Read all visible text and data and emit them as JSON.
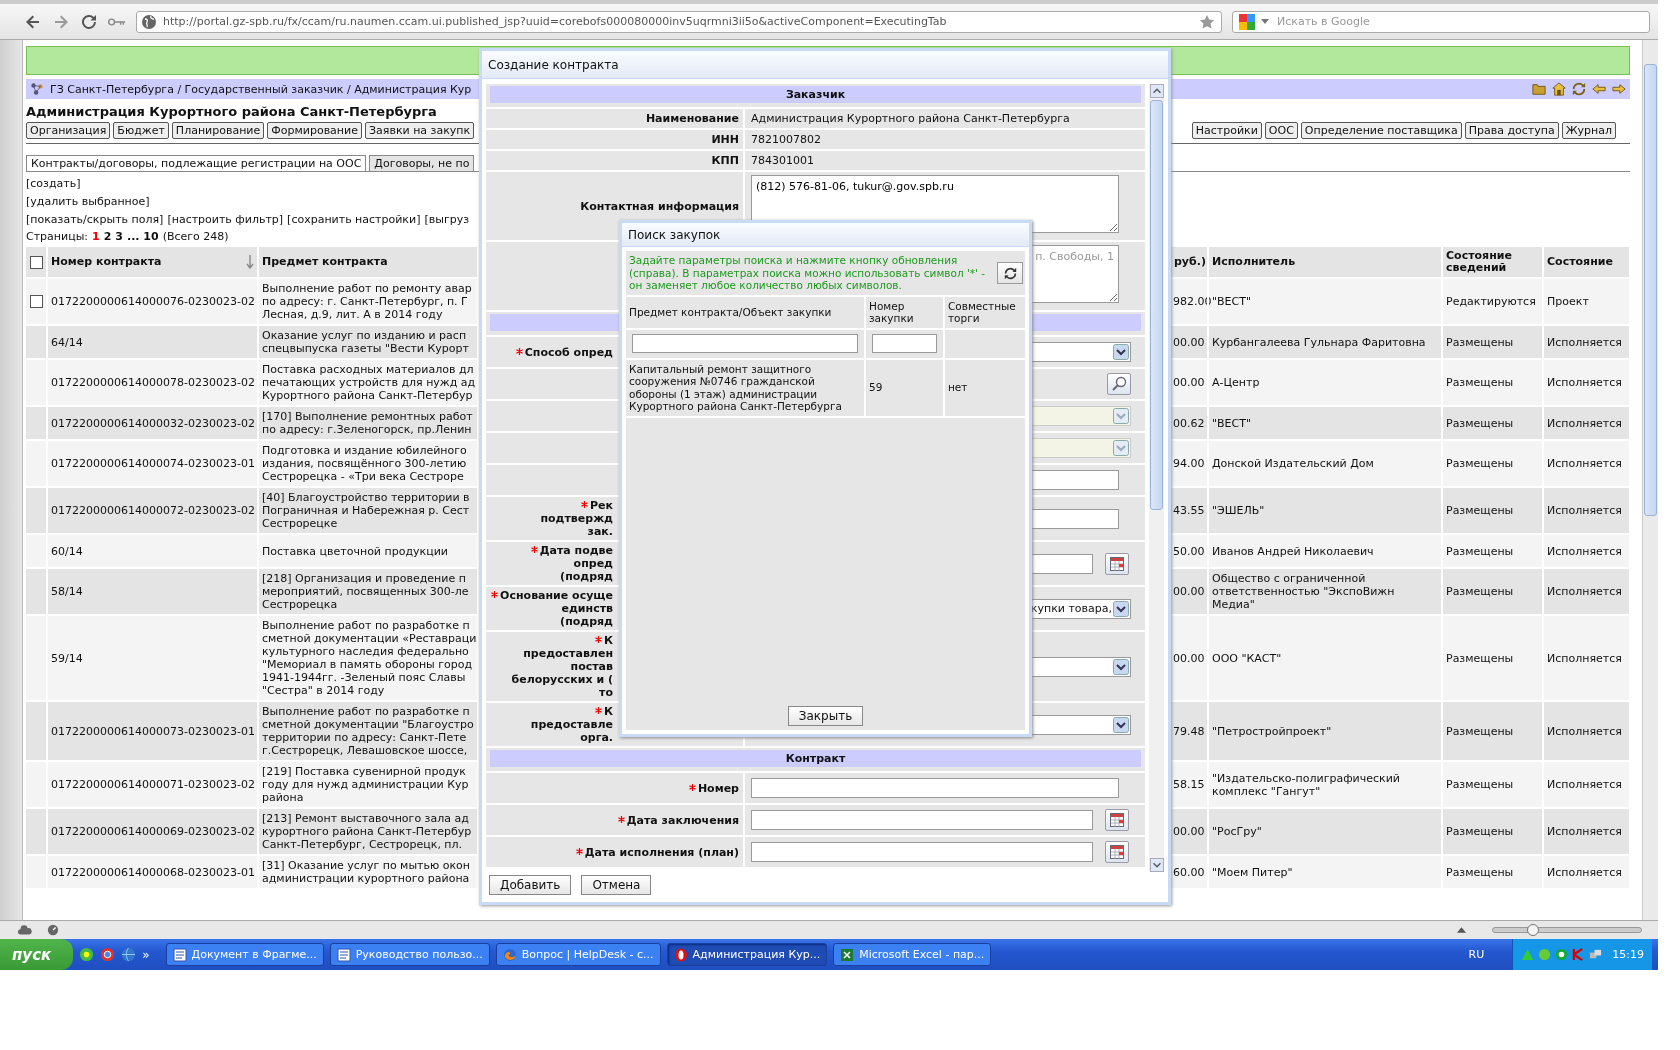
{
  "browser": {
    "url": "http://portal.gz-spb.ru/fx/ccam/ru.naumen.ccam.ui.published_jsp?uuid=corebofs000080000inv5uqrmni3ii5o&activeComponent=ExecutingTab",
    "search_placeholder": "Искать в Google"
  },
  "breadcrumb": "ГЗ Санкт-Петербурга / Государственный заказчик / Администрация Кур",
  "title": "Администрация Курортного района Санкт-Петербурга",
  "tabs": [
    {
      "label": "Организация",
      "selected": false
    },
    {
      "label": "Бюджет",
      "selected": false
    },
    {
      "label": "Планирование",
      "selected": false
    },
    {
      "label": "Формирование",
      "selected": false
    },
    {
      "label": "Заявки на закупк",
      "selected": false
    }
  ],
  "tabs_right": [
    {
      "label": "Настройки",
      "selected": false
    },
    {
      "label": "ООС",
      "selected": false
    },
    {
      "label": "Определение поставщика",
      "selected": false
    },
    {
      "label": "Права доступа",
      "selected": false
    },
    {
      "label": "Журнал",
      "selected": false
    }
  ],
  "subtabs": [
    {
      "label": "Контракты/договоры, подлежащие регистрации на ООС",
      "selected": true
    },
    {
      "label": "Договоры, не по",
      "selected": false
    }
  ],
  "actions": [
    "[создать]",
    "[удалить выбранное]"
  ],
  "links": [
    "[показать/скрыть поля]",
    "[настроить фильтр]",
    "[сохранить настройки]",
    "[выгруз"
  ],
  "pagination": {
    "label": "Страницы:",
    "pages": [
      {
        "label": "1",
        "selected": true
      },
      {
        "label": "2",
        "selected": false
      },
      {
        "label": "3",
        "selected": false
      },
      {
        "label": "... 10",
        "selected": false
      }
    ],
    "total": "(Всего 248)"
  },
  "table": {
    "select_all": {
      "checked": false
    },
    "columns": [
      {
        "label": "Номер контракта",
        "sorted": true
      },
      {
        "label": "Предмет контракта",
        "sorted": false
      },
      {
        "label": "руб.)"
      },
      {
        "label": "Исполнитель",
        "sorted": false
      },
      {
        "label": "Состояние сведений",
        "sorted": false
      },
      {
        "label": "Состояние",
        "sorted": false
      }
    ],
    "rows": [
      {
        "selectable": true,
        "checked": false,
        "number": "0172200000614000076-0230023-02",
        "subject": [
          "Выполнение работ по ремонту авар",
          "по адресу: г. Санкт-Петербург, п. Г",
          "Лесная, д.9, лит. А в 2014 году"
        ],
        "price": "982.00",
        "executor": "\"ВЕСТ\"",
        "info_state": "Редактируются",
        "state": "Проект"
      },
      {
        "selectable": false,
        "number": "64/14",
        "subject": [
          "Оказание услуг по изданию и расп",
          "спецвыпуска газеты \"Вести Курорт"
        ],
        "price": "00.00",
        "executor": "Курбангалеева Гульнара Фаритовна",
        "info_state": "Размещены",
        "state": "Исполняется"
      },
      {
        "selectable": false,
        "number": "0172200000614000078-0230023-02",
        "subject": [
          "Поставка расходных материалов дл",
          "печатающих устройств для нужд ад",
          "Курортного района Санкт-Петербур"
        ],
        "price": "00.00",
        "executor": "А-Центр",
        "info_state": "Размещены",
        "state": "Исполняется"
      },
      {
        "selectable": false,
        "number": "0172200000614000032-0230023-02",
        "subject": [
          "[170] Выполнение ремонтных работ",
          "по адресу: г.Зеленогорск, пр.Ленин"
        ],
        "price": "00.62",
        "executor": "\"ВЕСТ\"",
        "info_state": "Размещены",
        "state": "Исполняется"
      },
      {
        "selectable": false,
        "number": "0172200000614000074-0230023-01",
        "subject": [
          "Подготовка и издание юбилейного",
          "издания, посвящённого 300-летию",
          "Сестрорецка - «Три века Сестроре"
        ],
        "price": "94.00",
        "executor": "Донской Издательский Дом",
        "info_state": "Размещены",
        "state": "Исполняется"
      },
      {
        "selectable": false,
        "number": "0172200000614000072-0230023-02",
        "subject": [
          "[40] Благоустройство территории в",
          "Пограничная и Набережная р. Сест",
          "Сестрорецке"
        ],
        "price": "43.55",
        "executor": "\"ЭШЕЛЬ\"",
        "info_state": "Размещены",
        "state": "Исполняется"
      },
      {
        "selectable": false,
        "number": "60/14",
        "subject": [
          "Поставка цветочной продукции"
        ],
        "price": "50.00",
        "executor": "Иванов Андрей Николаевич",
        "info_state": "Размещены",
        "state": "Исполняется"
      },
      {
        "selectable": false,
        "number": "58/14",
        "subject": [
          "[218] Организация и проведение п",
          "мероприятий, посвященных 300-ле",
          "Сестрорецка"
        ],
        "price": "00.00",
        "executor": "Общество с ограниченной ответственностью \"ЭкспоВижн Медиа\"",
        "info_state": "Размещены",
        "state": "Исполняется"
      },
      {
        "selectable": false,
        "number": "59/14",
        "subject": [
          "Выполнение работ по разработке п",
          "сметной документации «Реставраци",
          "культурного наследия федерально",
          "\"Мемориал в память обороны город",
          "1941-1944гг. -Зеленый пояс Славы",
          "\"Сестра\" в 2014 году"
        ],
        "price": "00.00",
        "executor": "ООО \"КАСТ\"",
        "info_state": "Размещены",
        "state": "Исполняется"
      },
      {
        "selectable": false,
        "number": "0172200000614000073-0230023-01",
        "subject": [
          "Выполнение работ по разработке п",
          "сметной документации \"Благоустро",
          "территории по адресу: Санкт-Пете",
          "г.Сестрорецк, Левашовское шоссе,"
        ],
        "price": "79.48",
        "executor": "\"Петростройпроект\"",
        "info_state": "Размещены",
        "state": "Исполняется"
      },
      {
        "selectable": false,
        "number": "0172200000614000071-0230023-02",
        "subject": [
          "[219] Поставка сувенирной продук",
          "году для нужд администрации Кур",
          "района"
        ],
        "price": "58.15",
        "executor": "\"Издательско-полиграфический комплекс \"Гангут\"",
        "info_state": "Размещены",
        "state": "Исполняется"
      },
      {
        "selectable": false,
        "number": "0172200000614000069-0230023-02",
        "subject": [
          "[213] Ремонт выставочного зала ад",
          "курортного района Санкт-Петербур",
          "Санкт-Петербург, Сестрорецк, пл."
        ],
        "price": "00.00",
        "executor": "\"РосГру\"",
        "info_state": "Размещены",
        "state": "Исполняется"
      },
      {
        "selectable": false,
        "number": "0172200000614000068-0230023-01",
        "subject": [
          "[31] Оказание услуг по мытью окон",
          "администрации курортного района"
        ],
        "price": "60.00",
        "executor": "\"Моем Питер\"",
        "info_state": "Размещены",
        "state": "Исполняется"
      }
    ]
  },
  "contract_dialog": {
    "title": "Создание контракта",
    "rows": [
      {
        "kind": "header",
        "title": "Заказчик"
      },
      {
        "kind": "text",
        "label": [
          "Наименование"
        ],
        "required": false,
        "value": "Администрация Курортного района Санкт-Петербурга"
      },
      {
        "kind": "text",
        "label": [
          "ИНН"
        ],
        "required": false,
        "value": "7821007802"
      },
      {
        "kind": "text",
        "label": [
          "КПП"
        ],
        "required": false,
        "value": "784301001"
      },
      {
        "kind": "textarea",
        "label": [
          "Контактная информация"
        ],
        "required": false,
        "value": "(812) 576-81-06, tukur@.gov.spb.ru"
      },
      {
        "kind": "textarea",
        "placeholder": "п. Свободы, 1"
      },
      {
        "kind": "header"
      },
      {
        "kind": "select",
        "label": [
          "Способ опред"
        ],
        "required": true,
        "disabled": false
      },
      {
        "kind": "search"
      },
      {
        "kind": "select",
        "disabled": true
      },
      {
        "kind": "select",
        "disabled": true
      },
      {
        "kind": "input"
      },
      {
        "kind": "input",
        "label": [
          "Рек",
          "подтвержд",
          "зак."
        ],
        "required": true
      },
      {
        "kind": "date",
        "label": [
          "Дата подве",
          "опред",
          "(подряд"
        ],
        "required": true
      },
      {
        "kind": "select",
        "label": [
          "Основание осуще",
          "единств",
          "(подряд"
        ],
        "required": true,
        "disabled": false,
        "value": "купки товара,"
      },
      {
        "kind": "select",
        "label": [
          "К",
          "предоставлен",
          "постав",
          "белорусских и (",
          "то"
        ],
        "required": true,
        "disabled": false
      },
      {
        "kind": "select",
        "label": [
          "К",
          "предоставле",
          "орга."
        ],
        "required": true,
        "disabled": false
      },
      {
        "kind": "header",
        "title": "Контракт"
      },
      {
        "kind": "input",
        "label": [
          "Номер"
        ],
        "required": true
      },
      {
        "kind": "date",
        "label": [
          "Дата заключения"
        ],
        "required": true
      },
      {
        "kind": "date",
        "label": [
          "Дата исполнения (план)"
        ],
        "required": true
      }
    ],
    "buttons": [
      "Добавить",
      "Отмена"
    ]
  },
  "search_dialog": {
    "title": "Поиск закупок",
    "hint": "Задайте параметры поиска и нажмите кнопку обновления (справа). В параметрах поиска можно использовать символ '*' - он заменяет любое количество любых символов.",
    "columns": [
      {
        "label": "Предмет контракта/Объект закупки",
        "filterable": true
      },
      {
        "label": "Номер закупки",
        "filterable": true
      },
      {
        "label": "Совместные торги",
        "filterable": false
      }
    ],
    "rows": [
      {
        "cells": [
          "Капитальный ремонт защитного сооружения №0746 гражданской обороны (1 этаж) администрации Курортного района Санкт-Петербурга",
          "59",
          "нет"
        ]
      }
    ],
    "close_button": "Закрыть"
  },
  "status_bar": {
    "zoom_slider": {
      "level": 0.27
    }
  },
  "taskbar": {
    "start": "пуск",
    "more": "»",
    "tasks": [
      {
        "kind": "document",
        "label": "Документ в Фрагме...",
        "selected": false
      },
      {
        "kind": "document",
        "label": "Руководство пользо...",
        "selected": false
      },
      {
        "kind": "fox",
        "label": "Вопрос | HelpDesk - с...",
        "selected": false
      },
      {
        "kind": "opera",
        "label": "Администрация Кур...",
        "selected": true
      },
      {
        "kind": "excel",
        "label": "Microsoft Excel - пар...",
        "selected": false
      }
    ],
    "language": "RU",
    "time": "15:19"
  }
}
